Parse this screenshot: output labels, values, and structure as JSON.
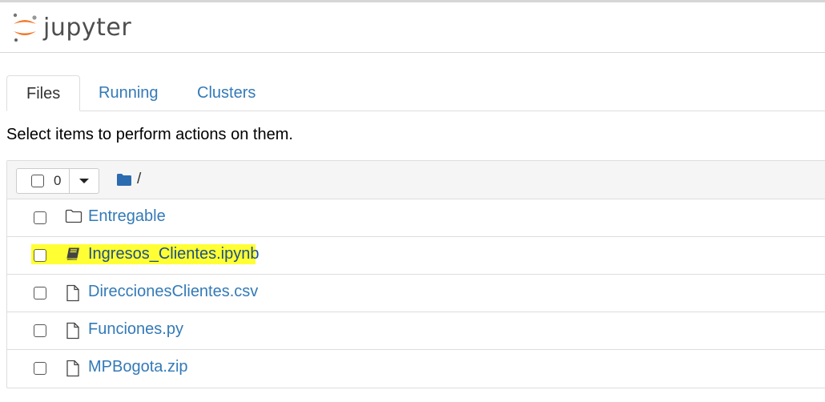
{
  "app": {
    "logo_text": "jupyter"
  },
  "tabs": [
    {
      "label": "Files",
      "active": true
    },
    {
      "label": "Running",
      "active": false
    },
    {
      "label": "Clusters",
      "active": false
    }
  ],
  "hint": "Select items to perform actions on them.",
  "file_list": {
    "selected_count": "0",
    "breadcrumb": "/",
    "items": [
      {
        "name": "Entregable",
        "type": "folder",
        "icon": "folder-icon",
        "highlighted": false
      },
      {
        "name": "Ingresos_Clientes.ipynb",
        "type": "notebook",
        "icon": "notebook-icon",
        "highlighted": true
      },
      {
        "name": "DireccionesClientes.csv",
        "type": "file",
        "icon": "file-icon",
        "highlighted": false
      },
      {
        "name": "Funciones.py",
        "type": "file",
        "icon": "file-icon",
        "highlighted": false
      },
      {
        "name": "MPBogota.zip",
        "type": "file",
        "icon": "file-icon",
        "highlighted": false
      }
    ]
  },
  "colors": {
    "link": "#337ab7",
    "highlight": "#ffff33",
    "logo_orange": "#f37726",
    "folder_blue": "#2b6cb0"
  }
}
